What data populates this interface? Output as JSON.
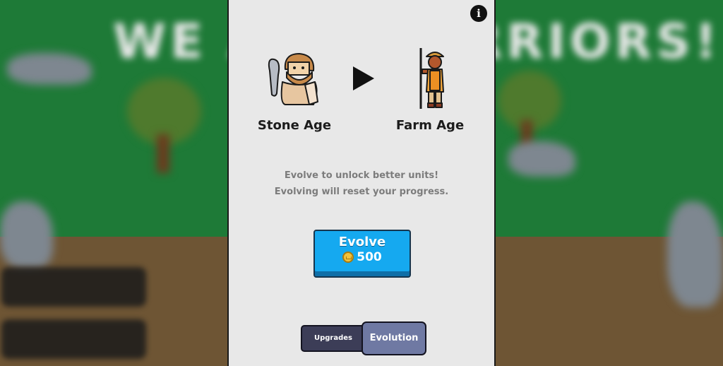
{
  "background": {
    "banner_text": "WE ARE WARRIORS!",
    "grass_color": "#1e7a37",
    "dirt_color": "#6e5534"
  },
  "panel": {
    "info_icon_glyph": "i",
    "current_age": {
      "name": "Stone Age",
      "icon": "caveman-icon"
    },
    "next_age": {
      "name": "Farm Age",
      "icon": "farmer-icon"
    },
    "transition_icon": "play-arrow-icon",
    "description_lines": [
      "Evolve to unlock better units!",
      "Evolving will reset your progress."
    ],
    "evolve_button": {
      "label": "Evolve",
      "cost": "500",
      "cost_icon": "crown-coin-icon",
      "color": "#15a9f0"
    },
    "tabs": [
      {
        "label": "Upgrades",
        "active": false
      },
      {
        "label": "Evolution",
        "active": true
      }
    ]
  }
}
